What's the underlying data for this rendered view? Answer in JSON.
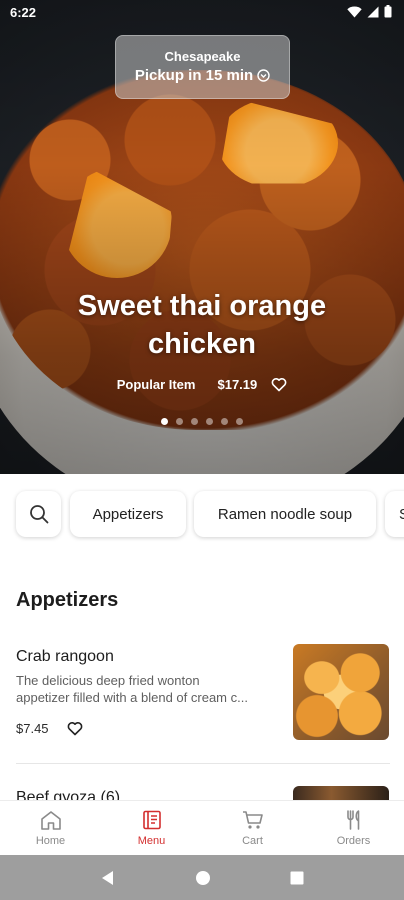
{
  "status_bar": {
    "time": "6:22"
  },
  "hero": {
    "store": "Chesapeake",
    "pickup": "Pickup in 15 min",
    "title": "Sweet thai orange chicken",
    "tag": "Popular Item",
    "price": "$17.19",
    "carousel_pages": 6,
    "carousel_active_index": 0
  },
  "categories": [
    "Appetizers",
    "Ramen noodle soup",
    "S"
  ],
  "section": {
    "title": "Appetizers"
  },
  "items": [
    {
      "name": "Crab rangoon",
      "desc_line1": "The delicious deep fried wonton",
      "desc_line2": "appetizer filled with a blend of cream c...",
      "price": "$7.45"
    },
    {
      "name": "Beef gyoza (6)"
    }
  ],
  "bottom_nav": {
    "home": "Home",
    "menu": "Menu",
    "cart": "Cart",
    "orders": "Orders",
    "active": "menu",
    "active_color": "#d32f2f"
  }
}
